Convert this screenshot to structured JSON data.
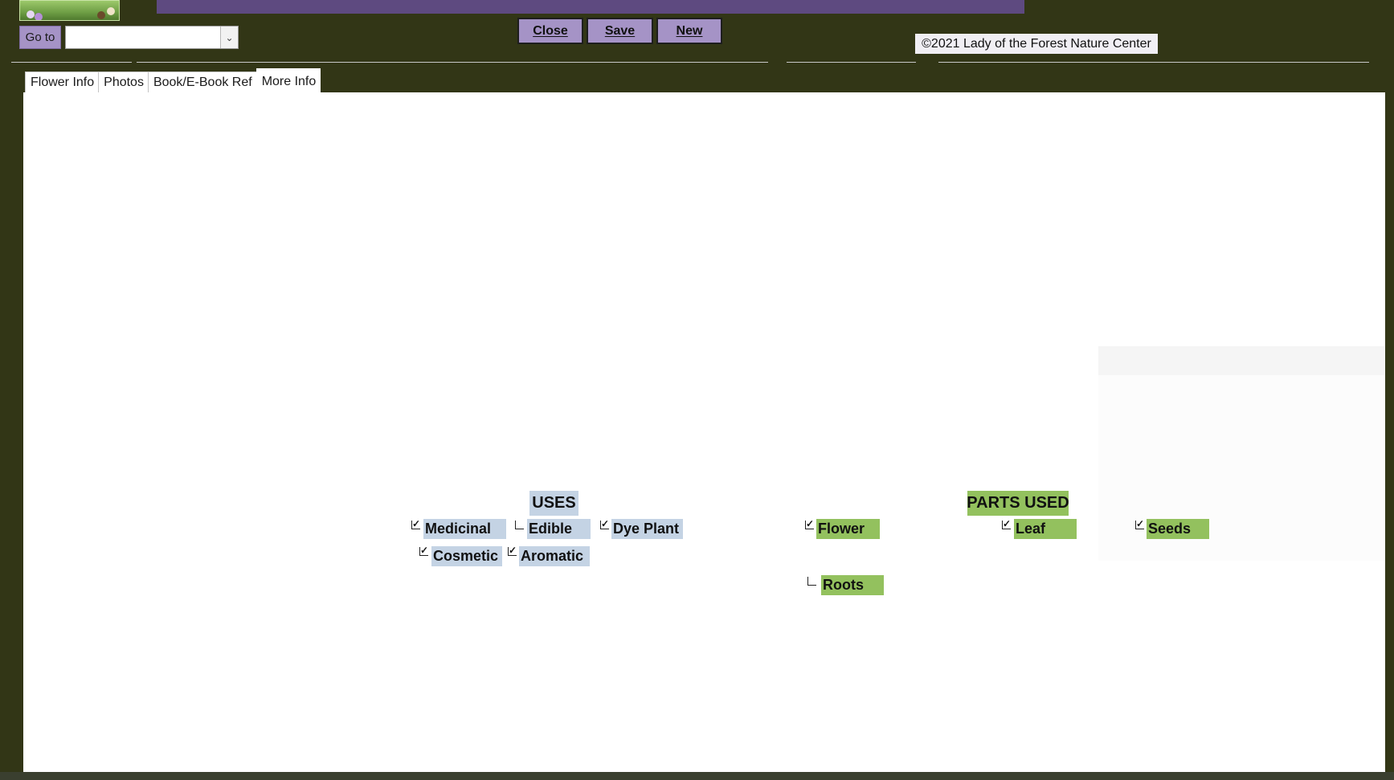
{
  "goto": {
    "label": "Go to",
    "value": ""
  },
  "toolbar": {
    "close_label": "Close",
    "save_label": "Save",
    "new_label": "New"
  },
  "copyright": "©2021 Lady of the Forest Nature Center",
  "tabs": [
    "Flower Info",
    "Photos",
    "Book/E-Book Ref",
    "More Info"
  ],
  "active_tab": "More Info",
  "uses": {
    "header": "USES",
    "items": [
      {
        "label": "Medicinal",
        "checked": true
      },
      {
        "label": "Edible",
        "checked": false
      },
      {
        "label": "Dye Plant",
        "checked": true
      },
      {
        "label": "Cosmetic",
        "checked": true
      },
      {
        "label": "Aromatic",
        "checked": true
      }
    ]
  },
  "parts_used": {
    "header": "PARTS USED",
    "items": [
      {
        "label": "Flower",
        "checked": true
      },
      {
        "label": "Leaf",
        "checked": true
      },
      {
        "label": "Seeds",
        "checked": true
      },
      {
        "label": "Roots",
        "checked": false
      }
    ]
  },
  "colors": {
    "background": "#323616",
    "button": "#a593c6",
    "title_bar": "#5e4a80",
    "uses_label": "#c4d3e4",
    "parts_label": "#93c15e"
  }
}
